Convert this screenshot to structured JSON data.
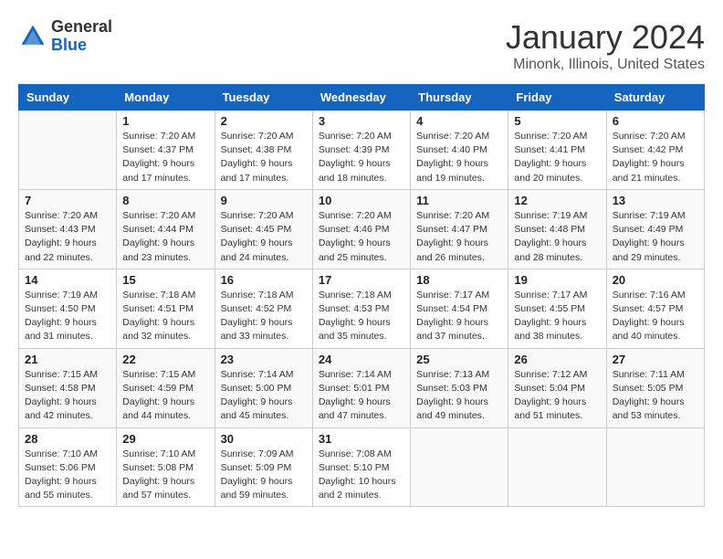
{
  "header": {
    "logo_line1": "General",
    "logo_line2": "Blue",
    "month_title": "January 2024",
    "location": "Minonk, Illinois, United States"
  },
  "weekdays": [
    "Sunday",
    "Monday",
    "Tuesday",
    "Wednesday",
    "Thursday",
    "Friday",
    "Saturday"
  ],
  "weeks": [
    [
      {
        "num": "",
        "empty": true
      },
      {
        "num": "1",
        "sunrise": "7:20 AM",
        "sunset": "4:37 PM",
        "daylight": "9 hours and 17 minutes."
      },
      {
        "num": "2",
        "sunrise": "7:20 AM",
        "sunset": "4:38 PM",
        "daylight": "9 hours and 17 minutes."
      },
      {
        "num": "3",
        "sunrise": "7:20 AM",
        "sunset": "4:39 PM",
        "daylight": "9 hours and 18 minutes."
      },
      {
        "num": "4",
        "sunrise": "7:20 AM",
        "sunset": "4:40 PM",
        "daylight": "9 hours and 19 minutes."
      },
      {
        "num": "5",
        "sunrise": "7:20 AM",
        "sunset": "4:41 PM",
        "daylight": "9 hours and 20 minutes."
      },
      {
        "num": "6",
        "sunrise": "7:20 AM",
        "sunset": "4:42 PM",
        "daylight": "9 hours and 21 minutes."
      }
    ],
    [
      {
        "num": "7",
        "sunrise": "7:20 AM",
        "sunset": "4:43 PM",
        "daylight": "9 hours and 22 minutes."
      },
      {
        "num": "8",
        "sunrise": "7:20 AM",
        "sunset": "4:44 PM",
        "daylight": "9 hours and 23 minutes."
      },
      {
        "num": "9",
        "sunrise": "7:20 AM",
        "sunset": "4:45 PM",
        "daylight": "9 hours and 24 minutes."
      },
      {
        "num": "10",
        "sunrise": "7:20 AM",
        "sunset": "4:46 PM",
        "daylight": "9 hours and 25 minutes."
      },
      {
        "num": "11",
        "sunrise": "7:20 AM",
        "sunset": "4:47 PM",
        "daylight": "9 hours and 26 minutes."
      },
      {
        "num": "12",
        "sunrise": "7:19 AM",
        "sunset": "4:48 PM",
        "daylight": "9 hours and 28 minutes."
      },
      {
        "num": "13",
        "sunrise": "7:19 AM",
        "sunset": "4:49 PM",
        "daylight": "9 hours and 29 minutes."
      }
    ],
    [
      {
        "num": "14",
        "sunrise": "7:19 AM",
        "sunset": "4:50 PM",
        "daylight": "9 hours and 31 minutes."
      },
      {
        "num": "15",
        "sunrise": "7:18 AM",
        "sunset": "4:51 PM",
        "daylight": "9 hours and 32 minutes."
      },
      {
        "num": "16",
        "sunrise": "7:18 AM",
        "sunset": "4:52 PM",
        "daylight": "9 hours and 33 minutes."
      },
      {
        "num": "17",
        "sunrise": "7:18 AM",
        "sunset": "4:53 PM",
        "daylight": "9 hours and 35 minutes."
      },
      {
        "num": "18",
        "sunrise": "7:17 AM",
        "sunset": "4:54 PM",
        "daylight": "9 hours and 37 minutes."
      },
      {
        "num": "19",
        "sunrise": "7:17 AM",
        "sunset": "4:55 PM",
        "daylight": "9 hours and 38 minutes."
      },
      {
        "num": "20",
        "sunrise": "7:16 AM",
        "sunset": "4:57 PM",
        "daylight": "9 hours and 40 minutes."
      }
    ],
    [
      {
        "num": "21",
        "sunrise": "7:15 AM",
        "sunset": "4:58 PM",
        "daylight": "9 hours and 42 minutes."
      },
      {
        "num": "22",
        "sunrise": "7:15 AM",
        "sunset": "4:59 PM",
        "daylight": "9 hours and 44 minutes."
      },
      {
        "num": "23",
        "sunrise": "7:14 AM",
        "sunset": "5:00 PM",
        "daylight": "9 hours and 45 minutes."
      },
      {
        "num": "24",
        "sunrise": "7:14 AM",
        "sunset": "5:01 PM",
        "daylight": "9 hours and 47 minutes."
      },
      {
        "num": "25",
        "sunrise": "7:13 AM",
        "sunset": "5:03 PM",
        "daylight": "9 hours and 49 minutes."
      },
      {
        "num": "26",
        "sunrise": "7:12 AM",
        "sunset": "5:04 PM",
        "daylight": "9 hours and 51 minutes."
      },
      {
        "num": "27",
        "sunrise": "7:11 AM",
        "sunset": "5:05 PM",
        "daylight": "9 hours and 53 minutes."
      }
    ],
    [
      {
        "num": "28",
        "sunrise": "7:10 AM",
        "sunset": "5:06 PM",
        "daylight": "9 hours and 55 minutes."
      },
      {
        "num": "29",
        "sunrise": "7:10 AM",
        "sunset": "5:08 PM",
        "daylight": "9 hours and 57 minutes."
      },
      {
        "num": "30",
        "sunrise": "7:09 AM",
        "sunset": "5:09 PM",
        "daylight": "9 hours and 59 minutes."
      },
      {
        "num": "31",
        "sunrise": "7:08 AM",
        "sunset": "5:10 PM",
        "daylight": "10 hours and 2 minutes."
      },
      {
        "num": "",
        "empty": true
      },
      {
        "num": "",
        "empty": true
      },
      {
        "num": "",
        "empty": true
      }
    ]
  ],
  "labels": {
    "sunrise_prefix": "Sunrise: ",
    "sunset_prefix": "Sunset: ",
    "daylight_prefix": "Daylight: "
  }
}
